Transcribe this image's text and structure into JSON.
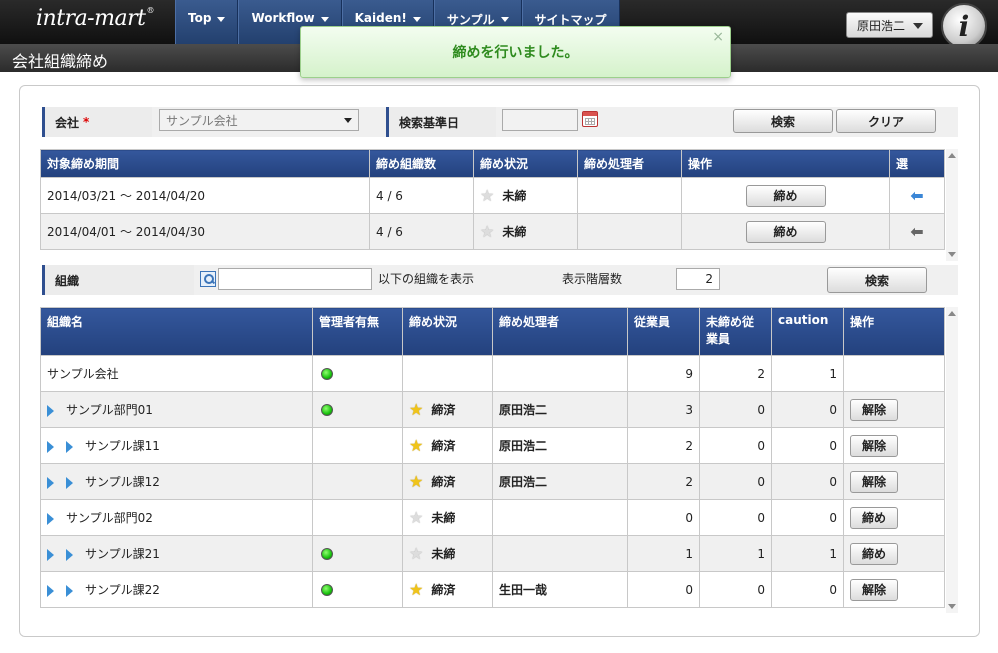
{
  "header": {
    "logo_text": "intra-mart",
    "logo_reg": "®",
    "nav": [
      {
        "label": "Top",
        "caret": true
      },
      {
        "label": "Workflow",
        "caret": true
      },
      {
        "label": "Kaiden!",
        "caret": true
      },
      {
        "label": "サンプル",
        "caret": true
      },
      {
        "label": "サイトマップ",
        "caret": false
      }
    ],
    "user_name": "原田浩二",
    "badge_letter": "i"
  },
  "page_title": "会社組織締め",
  "toast": {
    "message": "締めを行いました。",
    "close": "×"
  },
  "search_form": {
    "company_label": "会社",
    "required_mark": "*",
    "company_value": "サンプル会社",
    "base_date_label": "検索基準日",
    "base_date_value": "",
    "search_button": "検索",
    "clear_button": "クリア"
  },
  "period_table": {
    "headers": [
      "対象締め期間",
      "締め組織数",
      "締め状況",
      "締め処理者",
      "操作",
      "選"
    ],
    "rows": [
      {
        "period": "2014/03/21 ～ 2014/04/20",
        "count": "4 / 6",
        "status": "未締",
        "processor": "",
        "action": "締め",
        "selected": true
      },
      {
        "period": "2014/04/01 ～ 2014/04/30",
        "count": "4 / 6",
        "status": "未締",
        "processor": "",
        "action": "締め",
        "selected": false
      }
    ]
  },
  "org_form": {
    "org_label": "組織",
    "org_input_value": "",
    "org_suffix": "以下の組織を表示",
    "depth_label": "表示階層数",
    "depth_value": "2",
    "search_button": "検索"
  },
  "org_table": {
    "headers": [
      "組織名",
      "管理者有無",
      "締め状況",
      "締め処理者",
      "従業員",
      "未締め従業員",
      "caution",
      "操作"
    ],
    "rows": [
      {
        "level": 0,
        "name": "サンプル会社",
        "manager": true,
        "status": "",
        "status_on": false,
        "processor": "",
        "employees": "9",
        "unclosed": "2",
        "caution": "1",
        "action": ""
      },
      {
        "level": 1,
        "name": "サンプル部門01",
        "manager": true,
        "status": "締済",
        "status_on": true,
        "processor": "原田浩二",
        "employees": "3",
        "unclosed": "0",
        "caution": "0",
        "action": "解除"
      },
      {
        "level": 2,
        "name": "サンプル課11",
        "manager": false,
        "status": "締済",
        "status_on": true,
        "processor": "原田浩二",
        "employees": "2",
        "unclosed": "0",
        "caution": "0",
        "action": "解除"
      },
      {
        "level": 2,
        "name": "サンプル課12",
        "manager": false,
        "status": "締済",
        "status_on": true,
        "processor": "原田浩二",
        "employees": "2",
        "unclosed": "0",
        "caution": "0",
        "action": "解除"
      },
      {
        "level": 1,
        "name": "サンプル部門02",
        "manager": false,
        "status": "未締",
        "status_on": false,
        "processor": "",
        "employees": "0",
        "unclosed": "0",
        "caution": "0",
        "action": "締め"
      },
      {
        "level": 2,
        "name": "サンプル課21",
        "manager": true,
        "status": "未締",
        "status_on": false,
        "processor": "",
        "employees": "1",
        "unclosed": "1",
        "caution": "1",
        "action": "締め"
      },
      {
        "level": 2,
        "name": "サンプル課22",
        "manager": true,
        "status": "締済",
        "status_on": true,
        "processor": "生田一哉",
        "employees": "0",
        "unclosed": "0",
        "caution": "0",
        "action": "解除"
      }
    ]
  },
  "colors": {
    "header_blue": "#2a4a8a",
    "toast_text": "#2e8b1e",
    "star_on": "#f0c419",
    "manager_dot": "#19c10e",
    "tree_arrow": "#3a8fd6"
  }
}
